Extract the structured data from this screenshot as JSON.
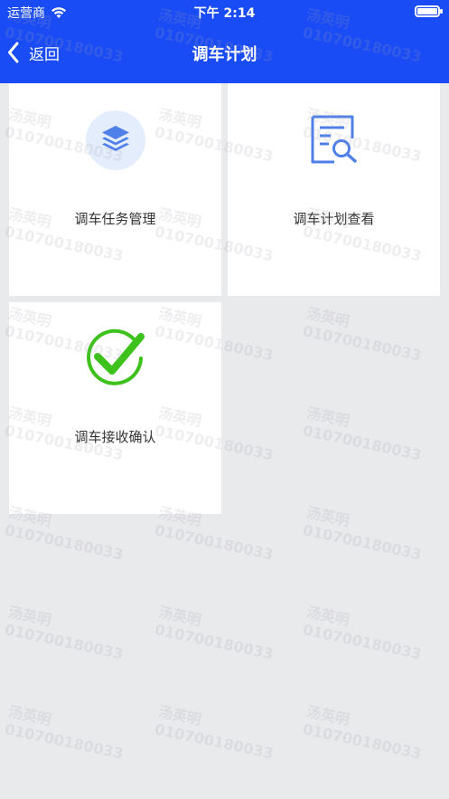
{
  "status_bar": {
    "carrier": "运营商",
    "time": "下午 2:14"
  },
  "nav": {
    "back_label": "返回",
    "title": "调车计划"
  },
  "cards": [
    {
      "label": "调车任务管理",
      "icon": "layers-icon"
    },
    {
      "label": "调车计划查看",
      "icon": "document-search-icon"
    },
    {
      "label": "调车接收确认",
      "icon": "check-circle-icon"
    }
  ],
  "watermark": {
    "name": "汤英明",
    "id": "010700180033"
  },
  "colors": {
    "nav_bg": "#1a4cf5",
    "accent_blue": "#4f7fe8",
    "success_green": "#3cc21b",
    "page_bg": "#e9eaec"
  }
}
